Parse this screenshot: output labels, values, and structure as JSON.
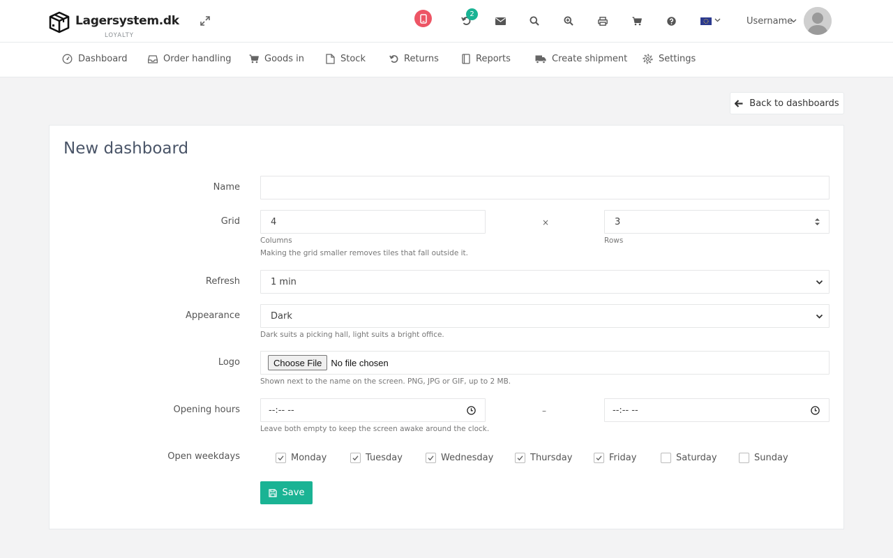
{
  "brand": {
    "name": "Lagersystem.dk",
    "tagline": "LOYALTY"
  },
  "header": {
    "icons": [
      "phone-icon",
      "undo-icon",
      "envelope-icon",
      "search-icon",
      "zoom-in-icon",
      "print-icon",
      "cart-icon",
      "help-icon",
      "flag-eu-icon"
    ],
    "badge_count": "2",
    "username": "Username"
  },
  "nav": {
    "items": [
      {
        "label": "Dashboard",
        "icon": "gauge-icon"
      },
      {
        "label": "Order handling",
        "icon": "inbox-icon"
      },
      {
        "label": "Goods in",
        "icon": "cart-icon"
      },
      {
        "label": "Stock",
        "icon": "file-icon"
      },
      {
        "label": "Returns",
        "icon": "undo-icon"
      },
      {
        "label": "Reports",
        "icon": "book-icon"
      },
      {
        "label": "Create shipment",
        "icon": "truck-icon"
      },
      {
        "label": "Settings",
        "icon": "gear-icon"
      }
    ]
  },
  "back_button": "Back to dashboards",
  "form": {
    "title": "New dashboard",
    "name": {
      "label": "Name",
      "value": ""
    },
    "grid": {
      "label": "Grid",
      "columns_value": "4",
      "columns_label": "Columns",
      "separator": "×",
      "rows_value": "3",
      "rows_label": "Rows",
      "help": "Making the grid smaller removes tiles that fall outside it."
    },
    "refresh": {
      "label": "Refresh",
      "value": "1 min"
    },
    "appearance": {
      "label": "Appearance",
      "value": "Dark",
      "help": "Dark suits a picking hall, light suits a bright office."
    },
    "logo": {
      "label": "Logo",
      "button": "Choose File",
      "status": "No file chosen",
      "help": "Shown next to the name on the screen. PNG, JPG or GIF, up to 2 MB."
    },
    "opening_hours": {
      "label": "Opening hours",
      "from": "--:-- --",
      "separator": "–",
      "to": "--:-- --",
      "help": "Leave both empty to keep the screen awake around the clock."
    },
    "weekdays": {
      "label": "Open weekdays",
      "days": [
        {
          "name": "Monday",
          "checked": true
        },
        {
          "name": "Tuesday",
          "checked": true
        },
        {
          "name": "Wednesday",
          "checked": true
        },
        {
          "name": "Thursday",
          "checked": true
        },
        {
          "name": "Friday",
          "checked": true
        },
        {
          "name": "Saturday",
          "checked": false
        },
        {
          "name": "Sunday",
          "checked": false
        }
      ]
    },
    "save_label": "Save"
  },
  "colors": {
    "primary": "#1ab394",
    "danger": "#ed5565",
    "text": "#676a6c"
  }
}
